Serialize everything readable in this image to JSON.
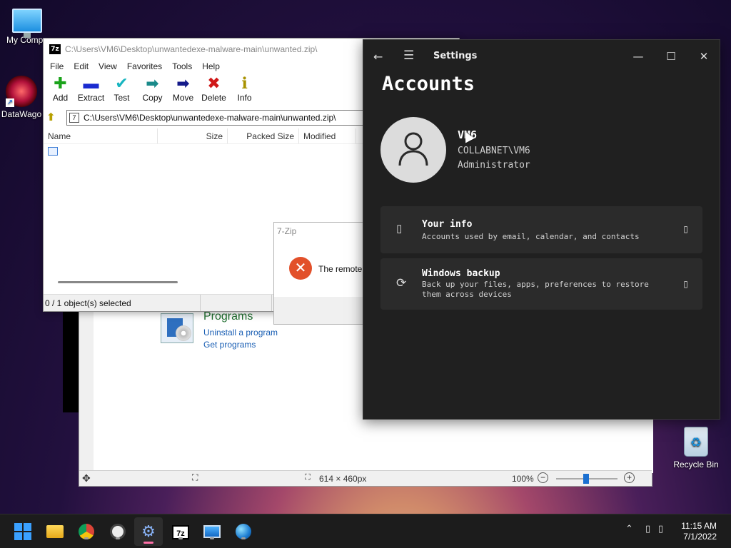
{
  "desktop": {
    "icons": [
      {
        "label": "My Compu",
        "icon": "monitor-icon"
      },
      {
        "label": "DataWago",
        "icon": "datawagon-icon"
      },
      {
        "label": "Recycle Bin",
        "icon": "recycle-bin-icon"
      }
    ]
  },
  "viewer": {
    "panel_title": "Programs",
    "links": [
      "Uninstall a program",
      "Get programs"
    ],
    "size_readout": "614 × 460px",
    "zoom": "100%",
    "zoom_minus": "−",
    "zoom_plus": "+"
  },
  "zip_window": {
    "title": "C:\\Users\\VM6\\Desktop\\unwantedexe-malware-main\\unwanted.zip\\",
    "logo": "7z",
    "menu": [
      "File",
      "Edit",
      "View",
      "Favorites",
      "Tools",
      "Help"
    ],
    "toolbar": [
      {
        "label": "Add",
        "icon": "plus-icon",
        "glyph": "✚",
        "color": "#1aa31a"
      },
      {
        "label": "Extract",
        "icon": "minus-icon",
        "glyph": "▬",
        "color": "#1a2bd0"
      },
      {
        "label": "Test",
        "icon": "check-icon",
        "glyph": "✔",
        "color": "#18b5c0"
      },
      {
        "label": "Copy",
        "icon": "copy-arrow-icon",
        "glyph": "➡",
        "color": "#1a8a8a"
      },
      {
        "label": "Move",
        "icon": "move-arrow-icon",
        "glyph": "➡",
        "color": "#141a8a"
      },
      {
        "label": "Delete",
        "icon": "delete-x-icon",
        "glyph": "✖",
        "color": "#d01818"
      },
      {
        "label": "Info",
        "icon": "info-icon",
        "glyph": "ℹ",
        "color": "#a89200"
      }
    ],
    "address": "C:\\Users\\VM6\\Desktop\\unwantedexe-malware-main\\unwanted.zip\\",
    "columns": [
      "Name",
      "Size",
      "Packed Size",
      "Modified"
    ],
    "status": "0 / 1 object(s) selected"
  },
  "error_dialog": {
    "title": "7-Zip",
    "message": "The remote"
  },
  "settings": {
    "app_title": "Settings",
    "heading": "Accounts",
    "user": {
      "name": "VM6",
      "domain": "COLLABNET\\VM6",
      "role": "Administrator"
    },
    "cards": [
      {
        "title": "Your info",
        "subtitle": "Accounts used by email, calendar, and contacts",
        "icon": "person-card-icon"
      },
      {
        "title": "Windows backup",
        "subtitle": "Back up your files, apps, preferences to restore them across devices",
        "icon": "backup-sync-icon"
      }
    ]
  },
  "taskbar": {
    "apps": [
      {
        "name": "start",
        "icon": "windows-start-icon"
      },
      {
        "name": "file-explorer",
        "icon": "folder-icon"
      },
      {
        "name": "chrome",
        "icon": "chrome-icon"
      },
      {
        "name": "clock-app",
        "icon": "clock-icon"
      },
      {
        "name": "settings",
        "icon": "gear-icon"
      },
      {
        "name": "7zip",
        "icon": "7zip-icon",
        "label": "7z"
      },
      {
        "name": "remote-desktop",
        "icon": "remote-desktop-icon"
      },
      {
        "name": "network",
        "icon": "globe-network-icon"
      }
    ],
    "time": "11:15 AM",
    "date": "7/1/2022"
  }
}
